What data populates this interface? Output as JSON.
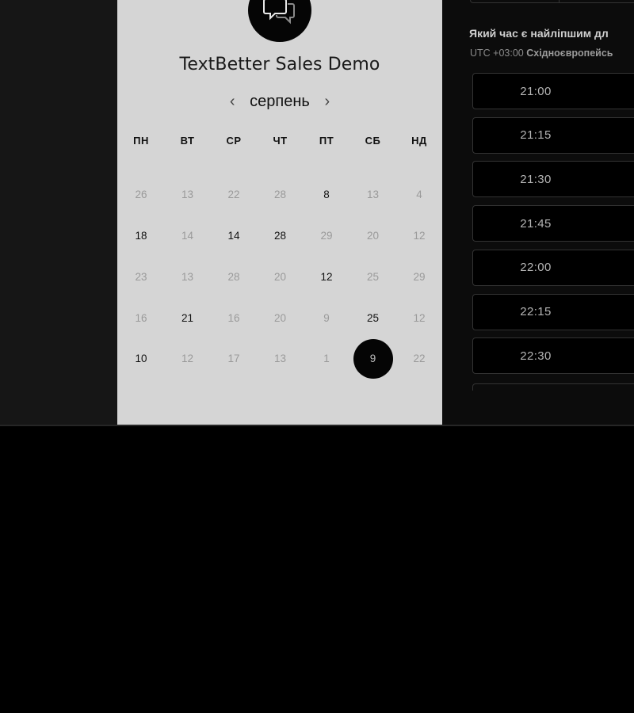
{
  "booking": {
    "title": "TextBetter Sales Demo",
    "logo_icon": "chat-bubbles-icon",
    "calendar": {
      "month": "серпень",
      "prev_icon": "chevron-left-icon",
      "next_icon": "chevron-right-icon",
      "weekdays": [
        "ПН",
        "ВТ",
        "СР",
        "ЧТ",
        "ПТ",
        "СБ",
        "НД"
      ],
      "weeks": [
        [
          {
            "d": "26",
            "on": false
          },
          {
            "d": "13",
            "on": false
          },
          {
            "d": "22",
            "on": false
          },
          {
            "d": "28",
            "on": false
          },
          {
            "d": "8",
            "on": true
          },
          {
            "d": "13",
            "on": false
          },
          {
            "d": "4",
            "on": false
          }
        ],
        [
          {
            "d": "18",
            "on": true
          },
          {
            "d": "14",
            "on": false
          },
          {
            "d": "14",
            "on": true
          },
          {
            "d": "28",
            "on": true
          },
          {
            "d": "29",
            "on": false
          },
          {
            "d": "20",
            "on": false
          },
          {
            "d": "12",
            "on": false
          }
        ],
        [
          {
            "d": "23",
            "on": false
          },
          {
            "d": "13",
            "on": false
          },
          {
            "d": "28",
            "on": false
          },
          {
            "d": "20",
            "on": false
          },
          {
            "d": "12",
            "on": true
          },
          {
            "d": "25",
            "on": false
          },
          {
            "d": "29",
            "on": false
          }
        ],
        [
          {
            "d": "16",
            "on": false
          },
          {
            "d": "21",
            "on": true
          },
          {
            "d": "16",
            "on": false
          },
          {
            "d": "20",
            "on": false
          },
          {
            "d": "9",
            "on": false
          },
          {
            "d": "25",
            "on": true
          },
          {
            "d": "12",
            "on": false
          }
        ],
        [
          {
            "d": "10",
            "on": true
          },
          {
            "d": "12",
            "on": false
          },
          {
            "d": "17",
            "on": false
          },
          {
            "d": "13",
            "on": false
          },
          {
            "d": "1",
            "on": false
          },
          {
            "d": "9",
            "on": false,
            "selected": true
          },
          {
            "d": "22",
            "on": false
          }
        ]
      ]
    }
  },
  "times": {
    "question": "Який час є найліпшим дл",
    "timezone_prefix": "UTC +03:00",
    "timezone_name": "Східноєвропейсь",
    "slots": [
      "21:00",
      "21:15",
      "21:30",
      "21:45",
      "22:00",
      "22:15",
      "22:30"
    ]
  },
  "colors": {
    "selected_day_bg": "#050505",
    "card_bg": "#d5d5d5",
    "page_bg": "#000000"
  }
}
